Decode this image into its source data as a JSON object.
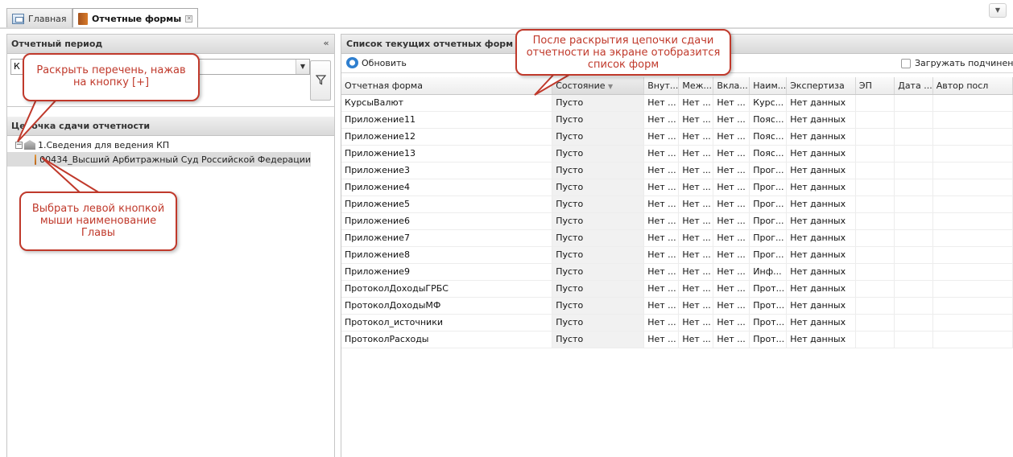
{
  "tabs": [
    {
      "label": "Главная",
      "icon": "home-page-icon"
    },
    {
      "label": "Отчетные формы",
      "icon": "book-icon"
    }
  ],
  "left_panel": {
    "period_title": "Отчетный период",
    "period_value": "К",
    "chain_title": "Цепочка сдачи отчетности",
    "tree": {
      "root": "1.Сведения для ведения КП",
      "child": "00434_Высший Арбитражный Суд Российской Федерации"
    }
  },
  "right_panel": {
    "title": "Список текущих отчетных форм",
    "refresh_label": "Обновить",
    "load_sub_label": "Загружать подчиненные",
    "columns": [
      "Отчетная форма",
      "Состояние",
      "Внут...",
      "Меж...",
      "Вкла...",
      "Наим...",
      "Экспертиза",
      "ЭП",
      "Дата ...",
      "Автор посл"
    ],
    "rows": [
      [
        "КурсыВалют",
        "Пусто",
        "Нет ...",
        "Нет ...",
        "Нет ...",
        "Курс...",
        "Нет данных"
      ],
      [
        "Приложение11",
        "Пусто",
        "Нет ...",
        "Нет ...",
        "Нет ...",
        "Пояс...",
        "Нет данных"
      ],
      [
        "Приложение12",
        "Пусто",
        "Нет ...",
        "Нет ...",
        "Нет ...",
        "Пояс...",
        "Нет данных"
      ],
      [
        "Приложение13",
        "Пусто",
        "Нет ...",
        "Нет ...",
        "Нет ...",
        "Пояс...",
        "Нет данных"
      ],
      [
        "Приложение3",
        "Пусто",
        "Нет ...",
        "Нет ...",
        "Нет ...",
        "Прог...",
        "Нет данных"
      ],
      [
        "Приложение4",
        "Пусто",
        "Нет ...",
        "Нет ...",
        "Нет ...",
        "Прог...",
        "Нет данных"
      ],
      [
        "Приложение5",
        "Пусто",
        "Нет ...",
        "Нет ...",
        "Нет ...",
        "Прог...",
        "Нет данных"
      ],
      [
        "Приложение6",
        "Пусто",
        "Нет ...",
        "Нет ...",
        "Нет ...",
        "Прог...",
        "Нет данных"
      ],
      [
        "Приложение7",
        "Пусто",
        "Нет ...",
        "Нет ...",
        "Нет ...",
        "Прог...",
        "Нет данных"
      ],
      [
        "Приложение8",
        "Пусто",
        "Нет ...",
        "Нет ...",
        "Нет ...",
        "Прог...",
        "Нет данных"
      ],
      [
        "Приложение9",
        "Пусто",
        "Нет ...",
        "Нет ...",
        "Нет ...",
        "Инф...",
        "Нет данных"
      ],
      [
        "ПротоколДоходыГРБС",
        "Пусто",
        "Нет ...",
        "Нет ...",
        "Нет ...",
        "Прот...",
        "Нет данных"
      ],
      [
        "ПротоколДоходыМФ",
        "Пусто",
        "Нет ...",
        "Нет ...",
        "Нет ...",
        "Прот...",
        "Нет данных"
      ],
      [
        "Протокол_источники",
        "Пусто",
        "Нет ...",
        "Нет ...",
        "Нет ...",
        "Прот...",
        "Нет данных"
      ],
      [
        "ПротоколРасходы",
        "Пусто",
        "Нет ...",
        "Нет ...",
        "Нет ...",
        "Прот...",
        "Нет данных"
      ]
    ]
  },
  "callouts": {
    "expand": "Раскрыть перечень, нажав на кнопку [+]",
    "select": "Выбрать левой кнопкой мыши наименование Главы",
    "list": "После раскрытия цепочки сдачи отчетности на экране отобразится список форм"
  },
  "colors": {
    "callout": "#c0392b",
    "panel_header": "#d9d9d9",
    "selected_row": "#dcdcdc"
  }
}
